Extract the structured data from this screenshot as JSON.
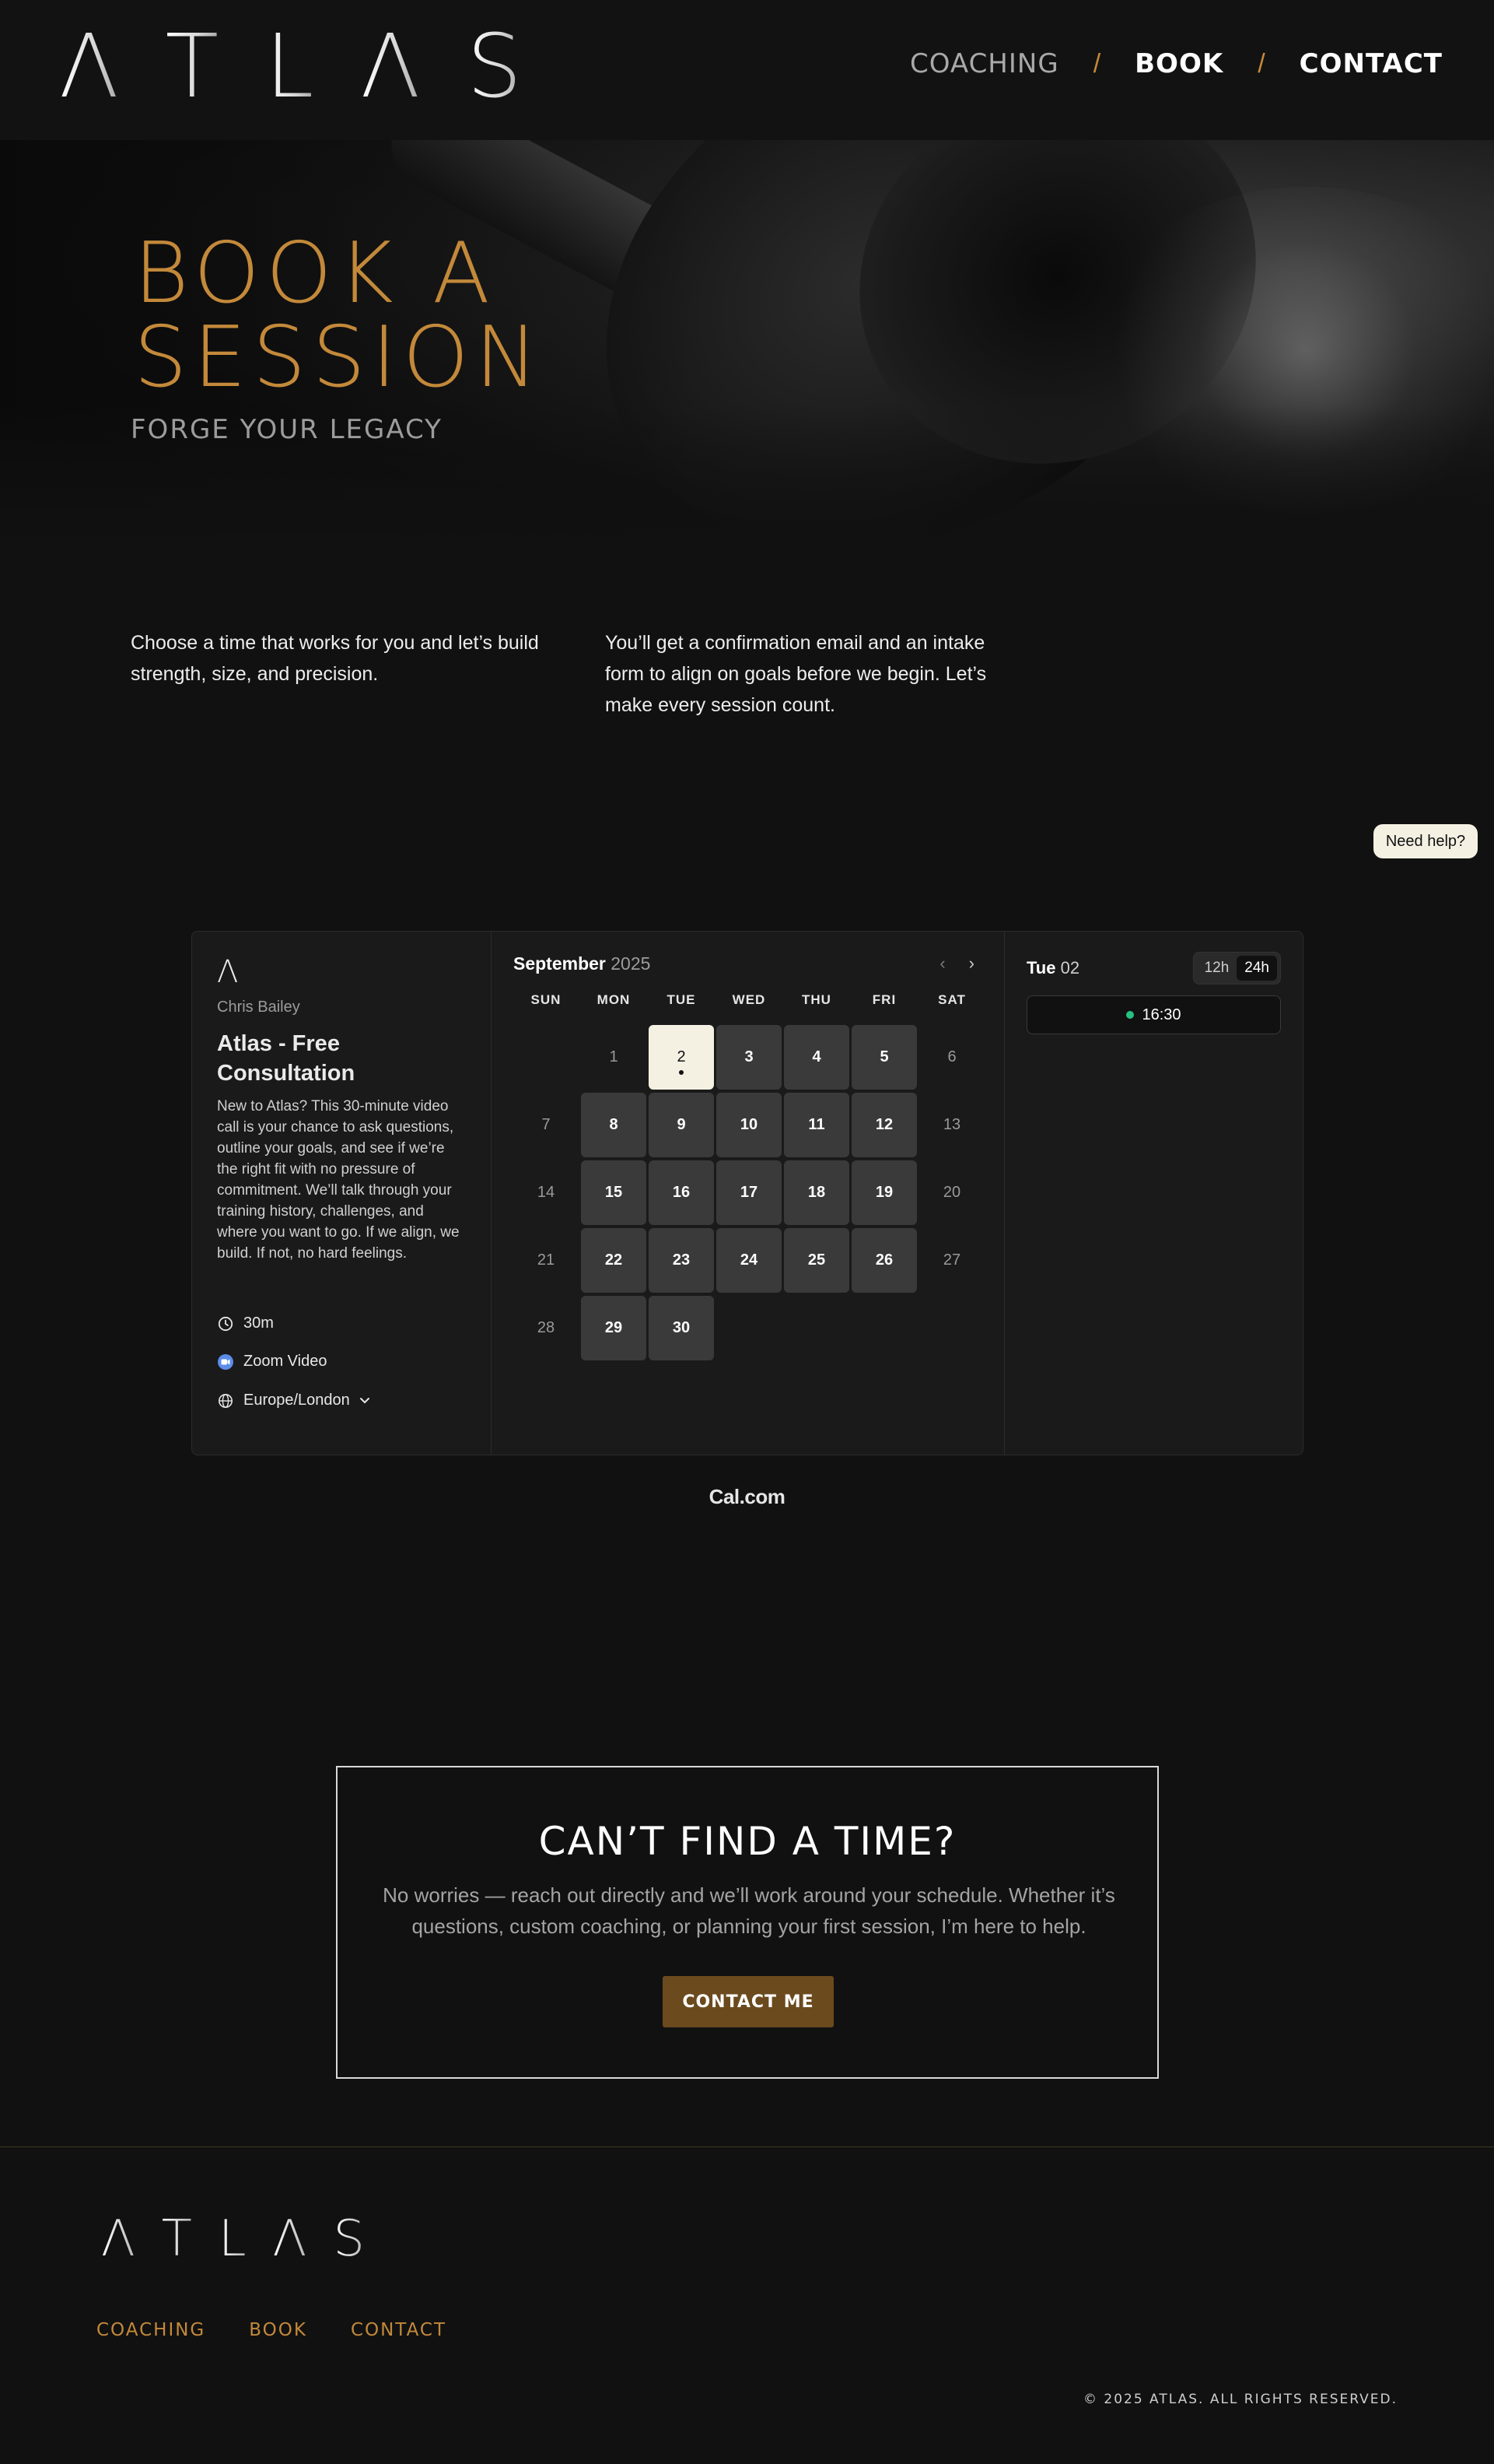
{
  "header": {
    "logo_letters": [
      "Λ",
      "T",
      "L",
      "Λ",
      "S"
    ],
    "nav": [
      {
        "label": "COACHING"
      },
      {
        "label": "BOOK"
      },
      {
        "label": "CONTACT"
      }
    ],
    "separator": "/"
  },
  "hero": {
    "title_line1": "BOOK A",
    "title_line2": "SESSION",
    "subtitle": "FORGE YOUR LEGACY"
  },
  "intro": {
    "left": "Choose a time that works for you and let’s build strength, size, and precision.",
    "right": "You’ll get a confirmation email and an intake form to align on goals before we begin. Let’s make every session count."
  },
  "help_button": "Need help?",
  "booking": {
    "brand_mark": "Λ",
    "host": "Chris Bailey",
    "event_title": "Atlas - Free Consultation",
    "description": "New to Atlas? This 30-minute video call is your chance to ask questions, outline your goals, and see if we’re the right fit with no pressure of commitment. We’ll talk through your training history, challenges, and where you want to go. If we align, we build. If not, no hard feelings.",
    "duration": "30m",
    "location": "Zoom Video",
    "timezone": "Europe/London",
    "calendar": {
      "month": "September",
      "year": "2025",
      "weekdays": [
        "SUN",
        "MON",
        "TUE",
        "WED",
        "THU",
        "FRI",
        "SAT"
      ],
      "days": [
        {
          "label": "",
          "state": "blank"
        },
        {
          "label": "1",
          "state": "off"
        },
        {
          "label": "2",
          "state": "sel"
        },
        {
          "label": "3",
          "state": "on"
        },
        {
          "label": "4",
          "state": "on"
        },
        {
          "label": "5",
          "state": "on"
        },
        {
          "label": "6",
          "state": "off"
        },
        {
          "label": "7",
          "state": "off"
        },
        {
          "label": "8",
          "state": "on"
        },
        {
          "label": "9",
          "state": "on"
        },
        {
          "label": "10",
          "state": "on"
        },
        {
          "label": "11",
          "state": "on"
        },
        {
          "label": "12",
          "state": "on"
        },
        {
          "label": "13",
          "state": "off"
        },
        {
          "label": "14",
          "state": "off"
        },
        {
          "label": "15",
          "state": "on"
        },
        {
          "label": "16",
          "state": "on"
        },
        {
          "label": "17",
          "state": "on"
        },
        {
          "label": "18",
          "state": "on"
        },
        {
          "label": "19",
          "state": "on"
        },
        {
          "label": "20",
          "state": "off"
        },
        {
          "label": "21",
          "state": "off"
        },
        {
          "label": "22",
          "state": "on"
        },
        {
          "label": "23",
          "state": "on"
        },
        {
          "label": "24",
          "state": "on"
        },
        {
          "label": "25",
          "state": "on"
        },
        {
          "label": "26",
          "state": "on"
        },
        {
          "label": "27",
          "state": "off"
        },
        {
          "label": "28",
          "state": "off"
        },
        {
          "label": "29",
          "state": "on"
        },
        {
          "label": "30",
          "state": "on"
        }
      ]
    },
    "selected_day": {
      "weekday": "Tue",
      "day": "02"
    },
    "time_format": {
      "option_12": "12h",
      "option_24": "24h",
      "active": "24h"
    },
    "slots": [
      "16:30"
    ],
    "slot_color": "#27c281"
  },
  "powered_by": "Cal.com",
  "cta": {
    "title": "CAN’T FIND A TIME?",
    "text": "No worries — reach out directly and we’ll work around your schedule. Whether it’s questions, custom coaching, or planning your first session, I’m here to help.",
    "button": "CONTACT ME"
  },
  "footer": {
    "logo_letters": [
      "Λ",
      "T",
      "L",
      "Λ",
      "S"
    ],
    "nav": [
      {
        "label": "COACHING"
      },
      {
        "label": "BOOK"
      },
      {
        "label": "CONTACT"
      }
    ],
    "copyright": "© 2025 ATLAS. ALL RIGHTS RESERVED."
  },
  "colors": {
    "accent": "#c3893a",
    "background": "#111111",
    "button_brown": "#6b4a1e",
    "selected_day": "#f4f1e3"
  }
}
